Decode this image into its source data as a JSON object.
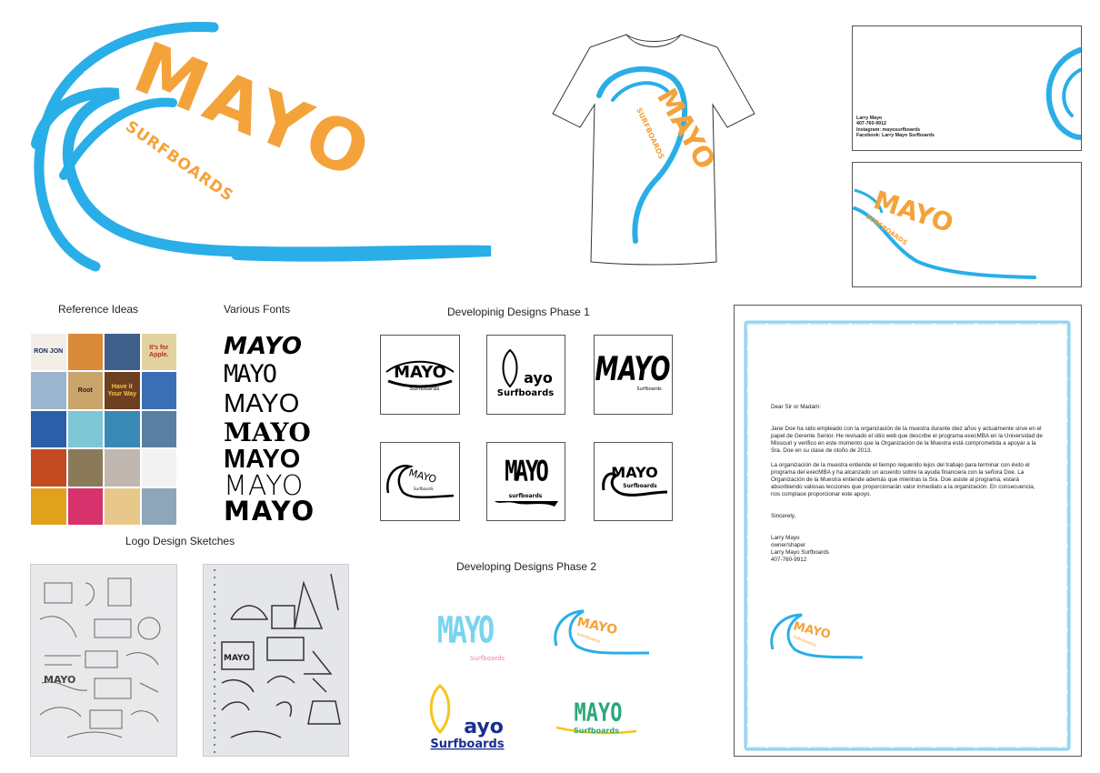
{
  "main_logo": {
    "title": "MAYO",
    "subtitle": "SURFBOARDS"
  },
  "tshirt_logo": {
    "title": "MAYO",
    "subtitle": "SURFBOARDS"
  },
  "business_card": {
    "lines": [
      "Larry Mayo",
      "407-760-9912",
      "Instagram: mayosurfboards",
      "Facebook: Larry Mayo Surfboards"
    ],
    "back_title": "MAYO",
    "back_subtitle": "SURFBOARDS"
  },
  "sections": {
    "reference_ideas": "Reference Ideas",
    "various_fonts": "Various Fonts",
    "phase1": "Developinig Designs Phase 1",
    "logo_sketches": "Logo Design Sketches",
    "phase2": "Developing Designs Phase 2"
  },
  "reference_tiles": [
    {
      "text": "RON JON",
      "bg": "#f3efe6",
      "fg": "#1a2a6b"
    },
    {
      "text": "",
      "bg": "#d98a3a",
      "fg": "#fff"
    },
    {
      "text": "",
      "bg": "#3d5f8a",
      "fg": "#fff"
    },
    {
      "text": "It's for Apple.",
      "bg": "#e3d2a1",
      "fg": "#b32d1f"
    },
    {
      "text": "",
      "bg": "#9bb4cf",
      "fg": "#fff"
    },
    {
      "text": "Root",
      "bg": "#c9a46b",
      "fg": "#222"
    },
    {
      "text": "Have it Your Way",
      "bg": "#6b3f1f",
      "fg": "#f2c14e"
    },
    {
      "text": "",
      "bg": "#3b6fb5",
      "fg": "#fff"
    },
    {
      "text": "",
      "bg": "#2d5fa8",
      "fg": "#fff"
    },
    {
      "text": "",
      "bg": "#7fc6d6",
      "fg": "#fff"
    },
    {
      "text": "",
      "bg": "#3a88b5",
      "fg": "#fff"
    },
    {
      "text": "",
      "bg": "#5a7fa0",
      "fg": "#fff"
    },
    {
      "text": "",
      "bg": "#c24a1e",
      "fg": "#fff"
    },
    {
      "text": "",
      "bg": "#8a7a5a",
      "fg": "#fff"
    },
    {
      "text": "",
      "bg": "#c0b8b0",
      "fg": "#fff"
    },
    {
      "text": "",
      "bg": "#f3f3f3",
      "fg": "#555"
    },
    {
      "text": "",
      "bg": "#e0a21c",
      "fg": "#fff"
    },
    {
      "text": "",
      "bg": "#d6326b",
      "fg": "#fff"
    },
    {
      "text": "",
      "bg": "#e8c88a",
      "fg": "#333"
    },
    {
      "text": "",
      "bg": "#8fa6b8",
      "fg": "#fff"
    }
  ],
  "font_samples": [
    "MAYO",
    "MAYO",
    "MAYO",
    "MAYO",
    "MAYO",
    "MAYO",
    "MAYO"
  ],
  "phase1_designs": [
    {
      "title": "MAYO",
      "subtitle": "Surfboards"
    },
    {
      "title": "ayo",
      "subtitle": "Surfboards"
    },
    {
      "title": "MAYO",
      "subtitle": "Surfboards"
    },
    {
      "title": "MAYO",
      "subtitle": "Surfboards"
    },
    {
      "title": "MAYO",
      "subtitle": "surfboards"
    },
    {
      "title": "MAYO",
      "subtitle": "Surfboards"
    }
  ],
  "phase2_designs": [
    {
      "title": "MAYO",
      "subtitle": "Surfboards"
    },
    {
      "title": "MAYO",
      "subtitle": "SURFBOARDS"
    },
    {
      "title": "ayo",
      "subtitle": "Surfboards"
    },
    {
      "title": "MAYO",
      "subtitle": "Surfboards"
    }
  ],
  "letter": {
    "greeting": "Dear Sir or Madam:",
    "para1": "Jane Doe ha sido empleado con la organización de la muestra durante diez años y actualmente sirve en el papel de Gerente Senior. He revisado el sitio web que describe el programa execMBA en la Universidad de Missouri y verifico en este momento que la Organización de la Muestra está comprometida a apoyar a la Sra. Doe en su clase de otoño de 2013.",
    "para2": "La organización de la muestra entiende el tiempo requerido lejos del trabajo para terminar con éxito el programa del execMBA y ha alcanzado un acuerdo sobre la ayuda financiera con la señora Doe. La Organización de la Muestra entiende además que mientras la Sra. Doe asiste al programa, estará absorbiendo valiosas lecciones que proporcionarán valor inmediato a la organización. En consecuencia, nos complace proporcionar este apoyo.",
    "closing": "Sincerely,",
    "sig": [
      "Larry Mayo",
      "owner/shaper",
      "Larry Mayo Surfboards",
      "407-760-9912"
    ],
    "logo_title": "MAYO",
    "logo_subtitle": "SURFBOARDS"
  },
  "colors": {
    "wave_blue": "#29aee8",
    "logo_orange": "#f4a33b",
    "black": "#000000",
    "green": "#2aa87a",
    "navy": "#1b2e8f",
    "yellow": "#f5c518",
    "pink": "#f07f8f",
    "light_blue": "#79d4ef"
  }
}
